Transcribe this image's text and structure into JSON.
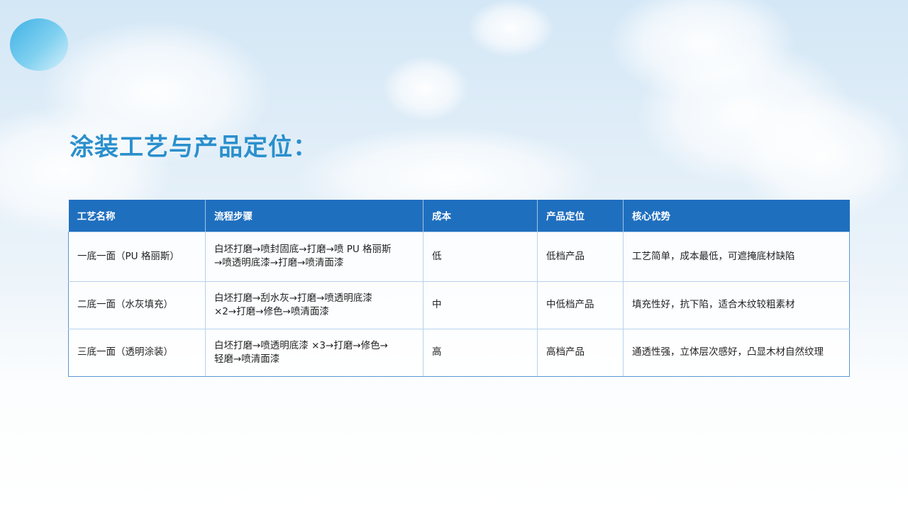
{
  "title": "涂装工艺与产品定位：",
  "table": {
    "headers": [
      "工艺名称",
      "流程步骤",
      "成本",
      "产品定位",
      "核心优势"
    ],
    "rows": [
      {
        "name": "一底一面（PU 格丽斯）",
        "steps_line1": "白坯打磨→喷封固底→打磨→喷 PU 格丽斯",
        "steps_line2": "→喷透明底漆→打磨→喷清面漆",
        "cost": "低",
        "position": "低档产品",
        "advantage": "工艺简单，成本最低，可遮掩底材缺陷"
      },
      {
        "name": "二底一面（水灰填充）",
        "steps_line1": "白坯打磨→刮水灰→打磨→喷透明底漆",
        "steps_line2": "×2→打磨→修色→喷清面漆",
        "cost": "中",
        "position": "中低档产品",
        "advantage": "填充性好，抗下陷，适合木纹较粗素材"
      },
      {
        "name": "三底一面（透明涂装）",
        "steps_line1": "白坯打磨→喷透明底漆 ×3→打磨→修色→",
        "steps_line2": "轻磨→喷清面漆",
        "cost": "高",
        "position": "高档产品",
        "advantage": "通透性强，立体层次感好，凸显木材自然纹理"
      }
    ]
  },
  "colors": {
    "title": "#2a8fcd",
    "header_bg": "#1f6fbf",
    "border": "#b7d3ec"
  }
}
